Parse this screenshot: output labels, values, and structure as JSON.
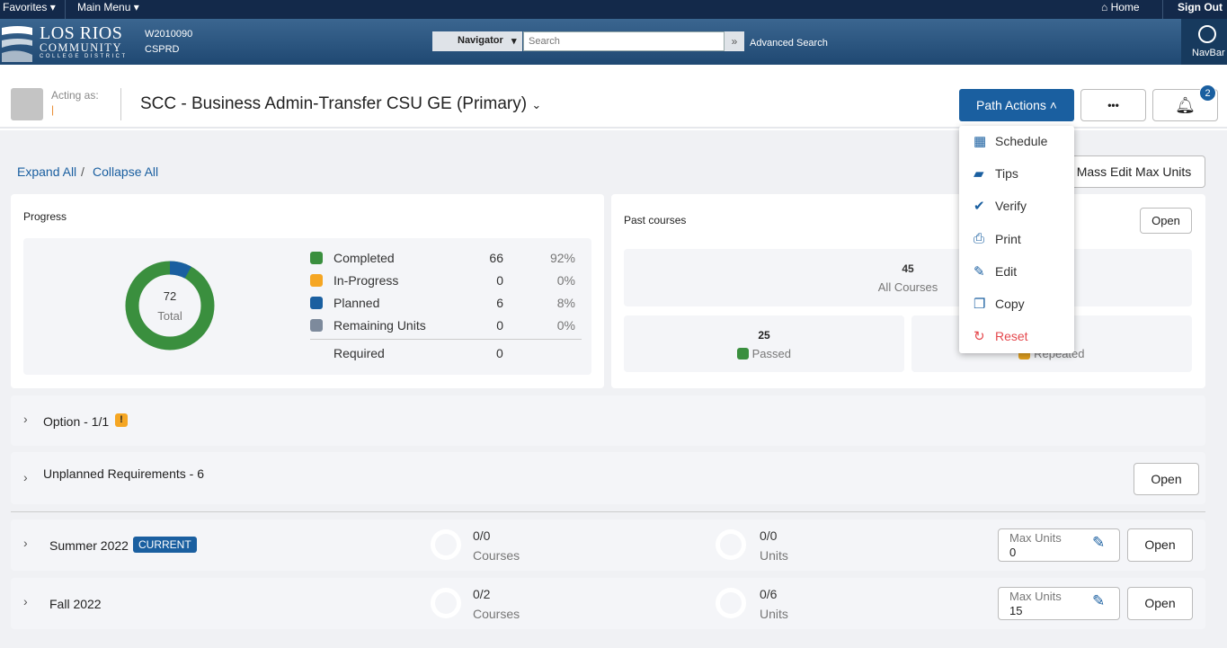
{
  "topbar": {
    "favorites": "Favorites",
    "main_menu": "Main Menu",
    "home": "Home",
    "sign_out": "Sign Out"
  },
  "banner": {
    "logo_line1": "LOS RIOS",
    "logo_line2": "COMMUNITY",
    "logo_line3": "COLLEGE DISTRICT",
    "env1": "W2010090",
    "env2": "CSPRD",
    "navigator": "Navigator",
    "search_placeholder": "Search",
    "advanced_search": "Advanced Search",
    "navbar": "NavBar"
  },
  "header": {
    "acting_as": "Acting as:",
    "acting_value": "|",
    "title": "SCC - Business Admin-Transfer CSU GE (Primary)",
    "path_actions": "Path Actions",
    "more": "•••",
    "notifications": "2"
  },
  "path_menu": [
    {
      "icon": "calendar-icon",
      "label": "Schedule"
    },
    {
      "icon": "chat-icon",
      "label": "Tips"
    },
    {
      "icon": "check-circle-icon",
      "label": "Verify"
    },
    {
      "icon": "printer-icon",
      "label": "Print"
    },
    {
      "icon": "pencil-icon",
      "label": "Edit"
    },
    {
      "icon": "copy-icon",
      "label": "Copy"
    },
    {
      "icon": "reset-icon",
      "label": "Reset"
    }
  ],
  "toolbar": {
    "expand_all": "Expand All",
    "sep": "/",
    "collapse_all": "Collapse All",
    "mass_edit": "Mass Edit Max Units"
  },
  "progress": {
    "title": "Progress",
    "total": "72",
    "total_label": "Total",
    "items": [
      {
        "label": "Completed",
        "value": "66",
        "pct": "92%",
        "color": "#3a8f3e"
      },
      {
        "label": "In-Progress",
        "value": "0",
        "pct": "0%",
        "color": "#f5a623"
      },
      {
        "label": "Planned",
        "value": "6",
        "pct": "8%",
        "color": "#1a5fa0"
      },
      {
        "label": "Remaining Units",
        "value": "0",
        "pct": "0%",
        "color": "#7d8a9c"
      }
    ],
    "required_label": "Required",
    "required_value": "0"
  },
  "past": {
    "title": "Past courses",
    "open": "Open",
    "all_value": "45",
    "all_label": "All Courses",
    "passed_value": "25",
    "passed_label": "Passed",
    "repeated_label": "Repeated"
  },
  "sections": [
    {
      "label": "Option - 1/1",
      "badge": "!"
    },
    {
      "label": "Unplanned Requirements - 6",
      "open": "Open"
    }
  ],
  "terms": [
    {
      "name": "Summer 2022",
      "badge": "CURRENT",
      "courses": "0/0",
      "courses_label": "Courses",
      "units": "0/0",
      "units_label": "Units",
      "max_label": "Max Units",
      "max_value": "0",
      "open": "Open"
    },
    {
      "name": "Fall 2022",
      "courses": "0/2",
      "courses_label": "Courses",
      "units": "0/6",
      "units_label": "Units",
      "max_label": "Max Units",
      "max_value": "15",
      "open": "Open"
    }
  ]
}
